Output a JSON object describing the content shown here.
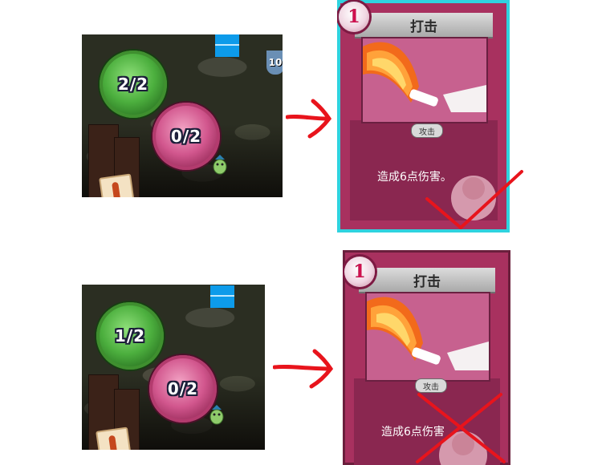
{
  "panels": [
    {
      "screenshot": {
        "energy_green": "2/2",
        "energy_pink": "0/2",
        "hud_number": "10"
      },
      "card": {
        "cost": "1",
        "title": "打击",
        "type": "攻击",
        "description": "造成6点伤害。"
      },
      "mark": "checkmark-icon"
    },
    {
      "screenshot": {
        "energy_green": "1/2",
        "energy_pink": "0/2"
      },
      "card": {
        "cost": "1",
        "title": "打击",
        "type": "攻击",
        "description": "造成6点伤害"
      },
      "mark": "cross-icon"
    }
  ],
  "colors": {
    "arrow": "#e8141c",
    "mark": "#e8141c",
    "card_frame": "#a8315f",
    "card_border_top": "#2fd3df"
  }
}
